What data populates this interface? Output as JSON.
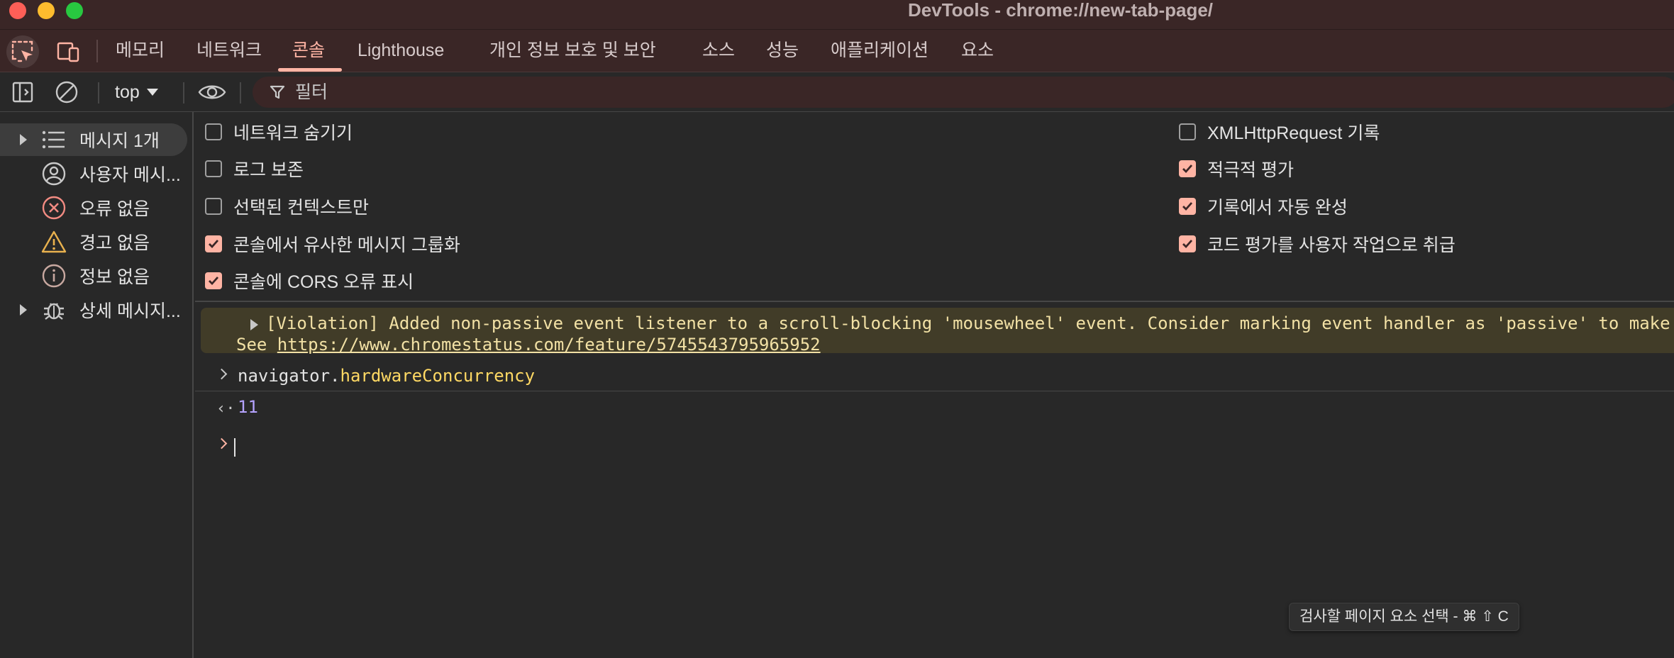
{
  "window": {
    "title": "DevTools - chrome://new-tab-page/"
  },
  "tabs": [
    {
      "label": "메모리",
      "active": false
    },
    {
      "label": "네트워크",
      "active": false
    },
    {
      "label": "콘솔",
      "active": true
    },
    {
      "label": "Lighthouse",
      "active": false
    },
    {
      "label": "개인 정보 보호 및 보안",
      "active": false
    },
    {
      "label": "소스",
      "active": false
    },
    {
      "label": "성능",
      "active": false
    },
    {
      "label": "애플리케이션",
      "active": false
    },
    {
      "label": "요소",
      "active": false
    }
  ],
  "toolbar": {
    "context": "top",
    "filter_placeholder": "필터"
  },
  "sidebar": {
    "items": [
      {
        "label": "메시지 1개",
        "icon": "list-icon",
        "expandable": true,
        "selected": true
      },
      {
        "label": "사용자 메시...",
        "icon": "user-icon",
        "expandable": false,
        "selected": false
      },
      {
        "label": "오류 없음",
        "icon": "error-icon",
        "expandable": false,
        "selected": false
      },
      {
        "label": "경고 없음",
        "icon": "warning-icon",
        "expandable": false,
        "selected": false
      },
      {
        "label": "정보 없음",
        "icon": "info-icon",
        "expandable": false,
        "selected": false
      },
      {
        "label": "상세 메시지...",
        "icon": "bug-icon",
        "expandable": true,
        "selected": false
      }
    ]
  },
  "settings": {
    "left": [
      {
        "label": "네트워크 숨기기",
        "checked": false
      },
      {
        "label": "로그 보존",
        "checked": false
      },
      {
        "label": "선택된 컨텍스트만",
        "checked": false
      },
      {
        "label": "콘솔에서 유사한 메시지 그룹화",
        "checked": true
      },
      {
        "label": "콘솔에 CORS 오류 표시",
        "checked": true
      }
    ],
    "right": [
      {
        "label": "XMLHttpRequest 기록",
        "checked": false
      },
      {
        "label": "적극적 평가",
        "checked": true
      },
      {
        "label": "기록에서 자동 완성",
        "checked": true
      },
      {
        "label": "코드 평가를 사용자 작업으로 취급",
        "checked": true
      }
    ]
  },
  "console": {
    "violation_line1": "[Violation] Added non-passive event listener to a scroll-blocking 'mousewheel' event. Consider marking event handler as 'passive' to make",
    "violation_see": "See ",
    "violation_link": "https://www.chromestatus.com/feature/5745543795965952",
    "input_object": "navigator.",
    "input_property": "hardwareConcurrency",
    "result_value": "11"
  },
  "tooltip": {
    "text": "검사할 페이지 요소 선택 - ⌘ ⇧ C"
  },
  "colors": {
    "accent": "#ffb4a4",
    "titlebar_bg": "#3a2626",
    "panel_bg": "#282828",
    "warning_bg": "#413c28",
    "warning_text": "#f2e1a5",
    "number": "#b5a3ff",
    "property": "#ffd964"
  }
}
